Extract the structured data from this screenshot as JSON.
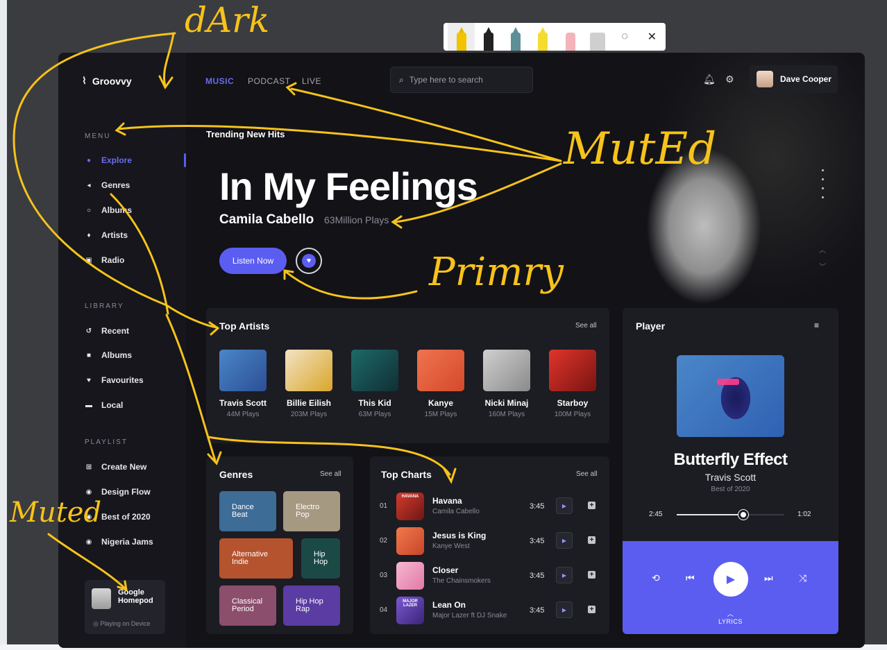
{
  "app": {
    "brand": "Groovvy",
    "brand_icon": "pulse-icon",
    "accent": "#5b5df0"
  },
  "sidebar": {
    "menu_title": "MENU",
    "menu": [
      {
        "label": "Explore",
        "icon": "compass-icon",
        "active": true
      },
      {
        "label": "Genres",
        "icon": "tag-icon"
      },
      {
        "label": "Albums",
        "icon": "disc-icon"
      },
      {
        "label": "Artists",
        "icon": "mic-icon"
      },
      {
        "label": "Radio",
        "icon": "radio-icon"
      }
    ],
    "library_title": "LIBRARY",
    "library": [
      {
        "label": "Recent",
        "icon": "history-icon"
      },
      {
        "label": "Albums",
        "icon": "album-icon"
      },
      {
        "label": "Favourites",
        "icon": "heart-icon"
      },
      {
        "label": "Local",
        "icon": "folder-icon"
      }
    ],
    "playlist_title": "PLAYLIST",
    "playlist": [
      {
        "label": "Create New",
        "icon": "plus-square-icon"
      },
      {
        "label": "Design Flow",
        "icon": "playlist-icon"
      },
      {
        "label": "Best of 2020",
        "icon": "playlist-icon"
      },
      {
        "label": "Nigeria Jams",
        "icon": "playlist-icon"
      }
    ],
    "device": {
      "name_line1": "Google",
      "name_line2": "Homepod",
      "status": "Playing on Device"
    }
  },
  "topnav": {
    "tabs": [
      {
        "label": "MUSIC",
        "active": true
      },
      {
        "label": "PODCAST"
      },
      {
        "label": "LIVE"
      }
    ],
    "search_placeholder": "Type here to search",
    "user_name": "Dave Cooper"
  },
  "hero": {
    "label": "Trending New Hits",
    "title": "In My Feelings",
    "artist": "Camila Cabello",
    "plays": "63Million Plays",
    "listen_label": "Listen Now"
  },
  "top_artists": {
    "title": "Top Artists",
    "see_all": "See all",
    "items": [
      {
        "name": "Travis Scott",
        "plays": "44M Plays"
      },
      {
        "name": "Billie Eilish",
        "plays": "203M Plays"
      },
      {
        "name": "This Kid",
        "plays": "63M Plays"
      },
      {
        "name": "Kanye",
        "plays": "15M Plays"
      },
      {
        "name": "Nicki Minaj",
        "plays": "160M Plays"
      },
      {
        "name": "Starboy",
        "plays": "100M Plays"
      }
    ]
  },
  "genres": {
    "title": "Genres",
    "see_all": "See all",
    "items": [
      {
        "line1": "Dance",
        "line2": "Beat",
        "color": "#3d6c97"
      },
      {
        "line1": "Electro",
        "line2": "Pop",
        "color": "#a69982"
      },
      {
        "line1": "Alternative",
        "line2": "Indie",
        "color": "#b5532f"
      },
      {
        "line1": "Hip",
        "line2": "Hop",
        "color": "#1b4a46"
      },
      {
        "line1": "Classical",
        "line2": "Period",
        "color": "#8c4e6d"
      },
      {
        "line1": "Hip Hop",
        "line2": "Rap",
        "color": "#5b3ca2"
      }
    ]
  },
  "top_charts": {
    "title": "Top Charts",
    "see_all": "See all",
    "items": [
      {
        "num": "01",
        "title": "Havana",
        "artist": "Camila Cabello",
        "duration": "3:45",
        "art_text": "HAVANA"
      },
      {
        "num": "02",
        "title": "Jesus is King",
        "artist": "Kanye West",
        "duration": "3:45"
      },
      {
        "num": "03",
        "title": "Closer",
        "artist": "The Chainsmokers",
        "duration": "3:45"
      },
      {
        "num": "04",
        "title": "Lean On",
        "artist": "Major Lazer ft DJ Snake",
        "duration": "3:45",
        "art_text": "MAJOR LAZER"
      }
    ]
  },
  "player": {
    "title": "Player",
    "song": "Butterfly Effect",
    "artist": "Travis Scott",
    "album": "Best of 2020",
    "elapsed": "2:45",
    "remaining": "1:02",
    "progress": 0.62,
    "lyrics": "LYRICS"
  },
  "annotations": {
    "dark": "dArk",
    "muted_top": "MutEd",
    "primary": "Primry",
    "muted_left": "Muted",
    "color": "#f7c31a"
  }
}
